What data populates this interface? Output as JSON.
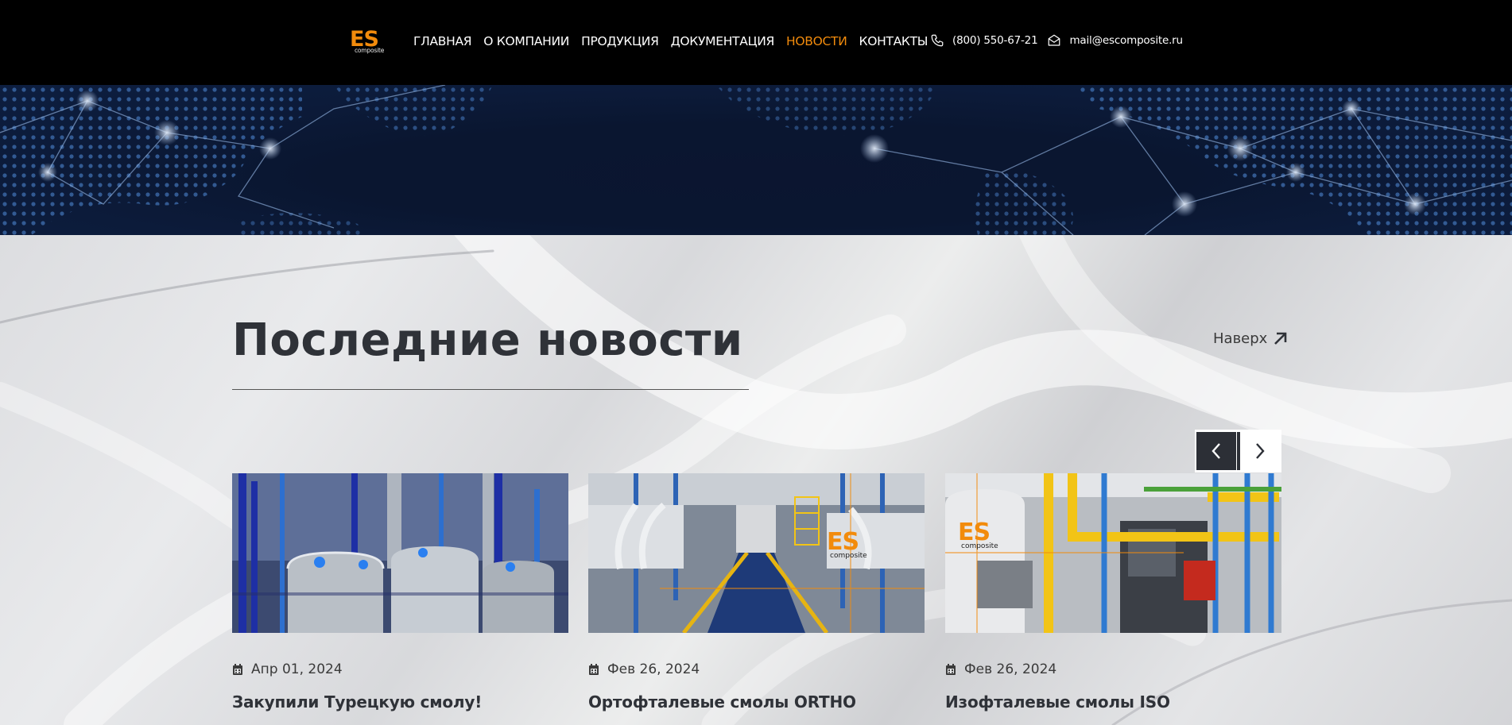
{
  "header": {
    "logo": {
      "main": "ES",
      "sub": "composite"
    },
    "nav": [
      {
        "label": "ГЛАВНАЯ",
        "active": false
      },
      {
        "label": "О КОМПАНИИ",
        "active": false
      },
      {
        "label": "ПРОДУКЦИЯ",
        "active": false
      },
      {
        "label": "ДОКУМЕНТАЦИЯ",
        "active": false
      },
      {
        "label": "НОВОСТИ",
        "active": true
      },
      {
        "label": "КОНТАКТЫ",
        "active": false
      }
    ],
    "phone": {
      "icon": "phone-icon",
      "text": "(800) 550-67-21"
    },
    "email": {
      "icon": "mail-icon",
      "text": "mail@escomposite.ru"
    }
  },
  "section": {
    "title": "Последние новости",
    "to_top": {
      "label": "Наверх",
      "icon": "arrow-up-right-icon"
    },
    "carousel": {
      "prev_icon": "chevron-left-icon",
      "next_icon": "chevron-right-icon"
    }
  },
  "news": [
    {
      "date": "Апр 01, 2024",
      "title": "Закупили Турецкую смолу!",
      "date_icon": "calendar-icon"
    },
    {
      "date": "Фев 26, 2024",
      "title": "Ортофталевые смолы ORTHO",
      "date_icon": "calendar-icon",
      "image_logo": {
        "main": "ES",
        "sub": "composite"
      }
    },
    {
      "date": "Фев 26, 2024",
      "title": "Изофталевые смолы ISO",
      "date_icon": "calendar-icon",
      "image_logo": {
        "main": "ES",
        "sub": "composite"
      }
    }
  ],
  "colors": {
    "accent": "#f28b0c",
    "header_bg": "#000000",
    "text_dark": "#2f3238",
    "banner": "#0b1530"
  }
}
